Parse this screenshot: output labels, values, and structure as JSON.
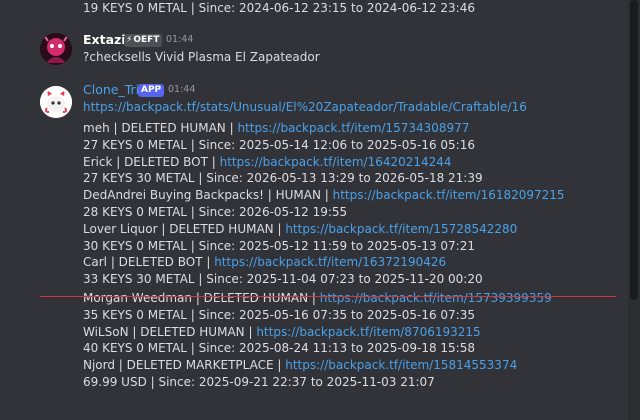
{
  "prev_message": {
    "last_line": "19 KEYS 0 METAL | Since: 2024-06-12 23:15 to 2024-06-12 23:46"
  },
  "message1": {
    "username": "Extazi",
    "tag": "OEFT",
    "timestamp": "01:44",
    "text": "?checksells Vivid Plasma El Zapateador",
    "colors": {
      "username": "#ffffff",
      "tag_bg": "#4e5058"
    }
  },
  "message2": {
    "username": "Clone_Tri",
    "app_badge": "APP",
    "timestamp": "01:44",
    "colors": {
      "username": "#4aa1e8",
      "badge_bg": "#5865f2",
      "link": "#4aa1e8",
      "new_divider": "#c9393f"
    },
    "url": "https://backpack.tf/stats/Unusual/El%20Zapateador/Tradable/Craftable/16",
    "entries": [
      {
        "prefix": "meh | DELETED HUMAN | ",
        "link": "https://backpack.tf/item/15734308977",
        "detail": "27 KEYS 0 METAL | Since: 2025-05-14 12:06 to 2025-05-16 05:16"
      },
      {
        "prefix": "Erick | DELETED BOT | ",
        "link": "https://backpack.tf/item/16420214244",
        "detail": "27 KEYS 30 METAL | Since: 2026-05-13 13:29 to 2026-05-18 21:39"
      },
      {
        "prefix": "DedAndrei Buying Backpacks! | HUMAN | ",
        "link": "https://backpack.tf/item/16182097215",
        "detail": "28 KEYS 0 METAL | Since: 2026-05-12 19:55"
      },
      {
        "prefix": "Lover Liquor | DELETED HUMAN | ",
        "link": "https://backpack.tf/item/15728542280",
        "detail": "30 KEYS 0 METAL | Since: 2025-05-12 11:59 to 2025-05-13 07:21"
      },
      {
        "prefix": "Carl | DELETED BOT | ",
        "link": "https://backpack.tf/item/16372190426",
        "detail": "33 KEYS 30 METAL | Since: 2025-11-04 07:23 to 2025-11-20 00:20"
      },
      {
        "prefix": "Morgan Weedman | DELETED HUMAN | ",
        "link": "https://backpack.tf/item/15739399359",
        "detail": "35 KEYS 0 METAL | Since: 2025-05-16 07:35 to 2025-05-16 07:35"
      },
      {
        "prefix": "WiLSoN | DELETED HUMAN | ",
        "link": "https://backpack.tf/item/8706193215",
        "detail": "40 KEYS 0 METAL | Since: 2025-08-24 11:13 to 2025-09-18 15:58"
      },
      {
        "prefix": "Njord | DELETED MARKETPLACE | ",
        "link": "https://backpack.tf/item/15814553374",
        "detail": "69.99 USD | Since: 2025-09-21 22:37 to 2025-11-03 21:07"
      }
    ]
  }
}
